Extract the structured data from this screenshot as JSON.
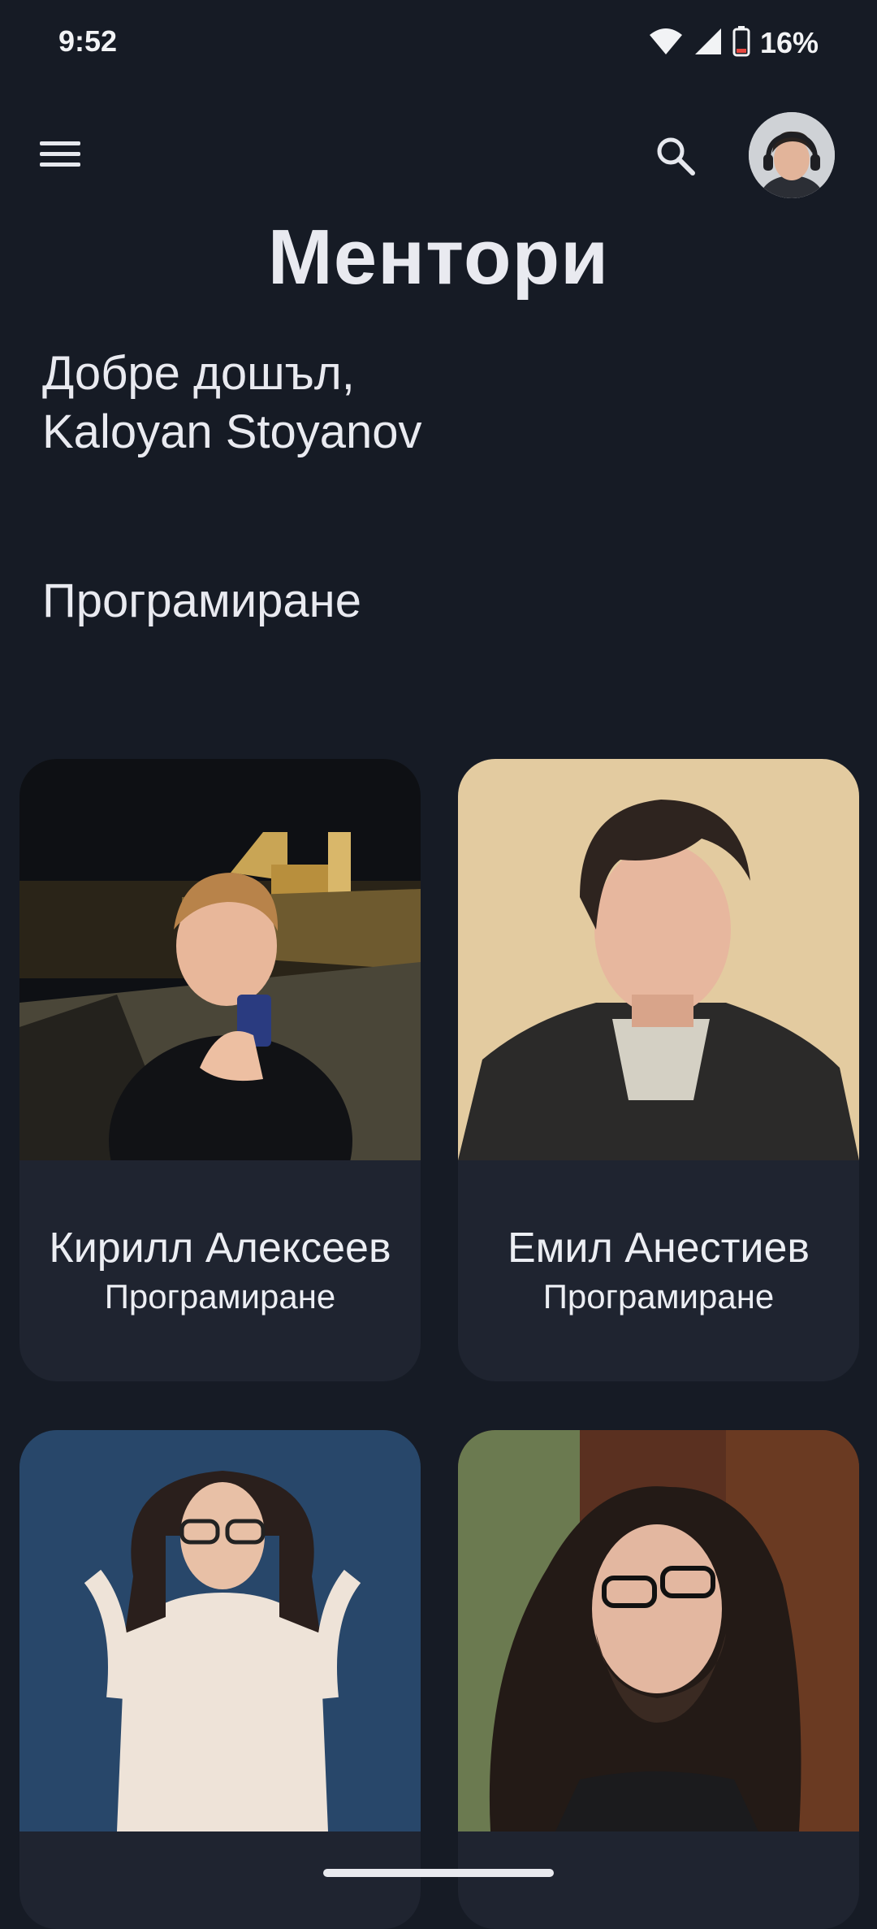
{
  "status_bar": {
    "time": "9:52",
    "battery_percent": "16%",
    "icons": [
      "wifi-icon",
      "signal-icon",
      "battery-icon"
    ]
  },
  "app_bar": {
    "menu_icon": "menu-icon",
    "search_icon": "search-icon",
    "avatar_icon": "user-avatar"
  },
  "page": {
    "title": "Ментори",
    "welcome_line1": "Добре дошъл,",
    "welcome_line2": "Kaloyan Stoyanov",
    "section_title": "Програмиране"
  },
  "mentors": [
    {
      "name": "Кирилл Алексеев",
      "field": "Програмиране"
    },
    {
      "name": "Емил Анестиев",
      "field": "Програмиране"
    },
    {
      "name": "",
      "field": ""
    },
    {
      "name": "",
      "field": ""
    }
  ],
  "colors": {
    "background": "#161b25",
    "card": "#1f2430",
    "text": "#e9eaf0"
  }
}
